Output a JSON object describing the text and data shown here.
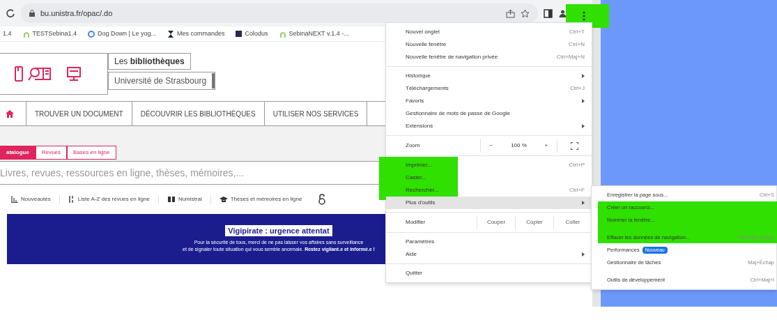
{
  "browser": {
    "url": "bu.unistra.fr/opac/.do",
    "bookmarks": [
      {
        "label": "1.4",
        "kind": "plain"
      },
      {
        "label": "TESTSebina1.4",
        "kind": "sebina"
      },
      {
        "label": "Dog Down | Le yog...",
        "kind": "google"
      },
      {
        "label": "Mes commandes",
        "kind": "hourglass"
      },
      {
        "label": "Colodus",
        "kind": "square"
      },
      {
        "label": "SebinaNEXT v.1.4 -...",
        "kind": "sebina"
      }
    ]
  },
  "page": {
    "logo": {
      "line1": "Les **bibliothèques**",
      "line2": "Université de Strasbourg"
    },
    "nav": [
      "TROUVER UN DOCUMENT",
      "DÉCOUVRIR LES BIBLIOTHÈQUES",
      "UTILISER NOS SERVICES"
    ],
    "search_tabs": [
      {
        "label": "atalogue",
        "selected": true
      },
      {
        "label": "Revues",
        "selected": false
      },
      {
        "label": "Bases en ligne",
        "selected": false
      }
    ],
    "search": {
      "placeholder": "Livres, revues, ressources en ligne, thèses, mémoires,..."
    },
    "quick_links": [
      {
        "label": "Nouveautés",
        "kind": "bars"
      },
      {
        "label": "Liste A-Z des revues en ligne",
        "kind": "az"
      },
      {
        "label": "Numistral",
        "kind": "book"
      },
      {
        "label": "Thèses et mémoires en ligne",
        "kind": "cap"
      }
    ],
    "alert": {
      "title": "Vigipirate : urgence attentat",
      "text_1": "Pour la sécurité de tous, merci de ne pas laisser vos affaires sans surveillance",
      "text_2": "et de signaler toute situation qui vous semble anormale. **Restez vigilant.e et informé.e !**"
    }
  },
  "menu": [
    {
      "kind": "item",
      "label": "Nouvel onglet",
      "shortcut": "Ctrl+T",
      "submenu": false,
      "selected": false
    },
    {
      "kind": "item",
      "label": "Nouvelle fenêtre",
      "shortcut": "Ctrl+N",
      "submenu": false,
      "selected": false
    },
    {
      "kind": "item",
      "label": "Nouvelle fenêtre de navigation privée",
      "shortcut": "Ctrl+Maj+N",
      "submenu": false,
      "selected": false
    },
    {
      "kind": "divider"
    },
    {
      "kind": "item",
      "label": "Historique",
      "submenu": true,
      "selected": false
    },
    {
      "kind": "item",
      "label": "Téléchargements",
      "shortcut": "Ctrl+J",
      "submenu": false,
      "selected": false
    },
    {
      "kind": "item",
      "label": "Favoris",
      "submenu": true,
      "selected": false
    },
    {
      "kind": "item",
      "label": "Gestionnaire de mots de passe de Google",
      "submenu": false,
      "selected": false
    },
    {
      "kind": "item",
      "label": "Extensions",
      "submenu": true,
      "selected": false
    },
    {
      "kind": "divider"
    },
    {
      "kind": "zoom",
      "label": "Zoom",
      "minus": "−",
      "value": "100 %",
      "plus": "+"
    },
    {
      "kind": "divider"
    },
    {
      "kind": "item",
      "label": "Imprimer...",
      "shortcut": "Ctrl+P",
      "submenu": false,
      "selected": false
    },
    {
      "kind": "item",
      "label": "Caster...",
      "submenu": false,
      "selected": false
    },
    {
      "kind": "item",
      "label": "Rechercher...",
      "shortcut": "Ctrl+F",
      "submenu": false,
      "selected": false
    },
    {
      "kind": "item",
      "label": "Plus d'outils",
      "submenu": true,
      "selected": true
    },
    {
      "kind": "divider"
    },
    {
      "kind": "edit",
      "label": "Modifier",
      "buttons": [
        "Couper",
        "Copier",
        "Coller"
      ]
    },
    {
      "kind": "divider"
    },
    {
      "kind": "item",
      "label": "Paramètres",
      "submenu": false,
      "selected": false
    },
    {
      "kind": "item",
      "label": "Aide",
      "submenu": true,
      "selected": false
    },
    {
      "kind": "divider"
    },
    {
      "kind": "item",
      "label": "Quitter",
      "submenu": false,
      "selected": false
    }
  ],
  "submenu": [
    {
      "kind": "item",
      "label": "Enregistrer la page sous...",
      "shortcut": "Ctrl+S"
    },
    {
      "kind": "item",
      "label": "Créer un raccourci..."
    },
    {
      "kind": "item",
      "label": "Nommer la fenêtre..."
    },
    {
      "kind": "divider"
    },
    {
      "kind": "item",
      "label": "Effacer les données de navigation...",
      "shortcut": "Ctrl+Maj+Suppr"
    },
    {
      "kind": "item",
      "label": "Performances",
      "badge": "Nouveau"
    },
    {
      "kind": "item",
      "label": "Gestionnaire de tâches",
      "shortcut": "Maj+Échap"
    },
    {
      "kind": "divider"
    },
    {
      "kind": "item",
      "label": "Outils de développement",
      "shortcut": "Ctrl+Maj+I"
    }
  ]
}
